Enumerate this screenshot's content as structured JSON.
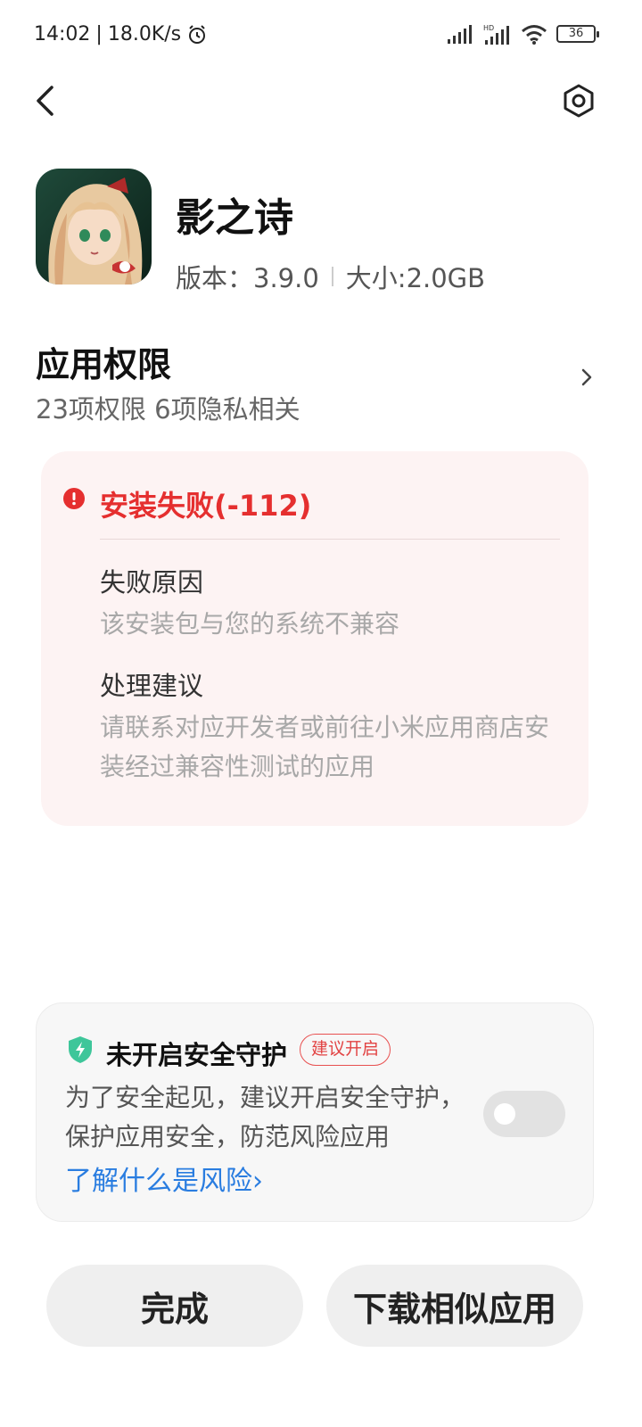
{
  "status_bar": {
    "time": "14:02",
    "network_speed": "18.0K/s",
    "battery": "36",
    "icons": [
      "alarm-icon",
      "signal-icon",
      "hd-signal-icon",
      "wifi-icon",
      "battery-icon"
    ]
  },
  "header": {
    "back_icon": "chevron-left-icon",
    "settings_icon": "hexagon-settings-icon"
  },
  "app": {
    "name": "影之诗",
    "version": "版本：3.9.0",
    "size": "大小:2.0GB"
  },
  "permissions": {
    "title": "应用权限",
    "summary": "23项权限 6项隐私相关"
  },
  "install_error": {
    "title": "安装失败(-112)",
    "reason_label": "失败原因",
    "reason_text": "该安装包与您的系统不兼容",
    "advice_label": "处理建议",
    "advice_text": "请联系对应开发者或前往小米应用商店安装经过兼容性测试的应用"
  },
  "security_guard": {
    "title": "未开启安全守护",
    "badge": "建议开启",
    "description": "为了安全起见，建议开启安全守护，保护应用安全，防范风险应用",
    "link": "了解什么是风险›",
    "enabled": false
  },
  "buttons": {
    "done": "完成",
    "download_similar": "下载相似应用"
  },
  "colors": {
    "error": "#e52f2f",
    "error_card_bg": "#fdf3f3",
    "link": "#2a7de0",
    "shield": "#3ec69a"
  }
}
